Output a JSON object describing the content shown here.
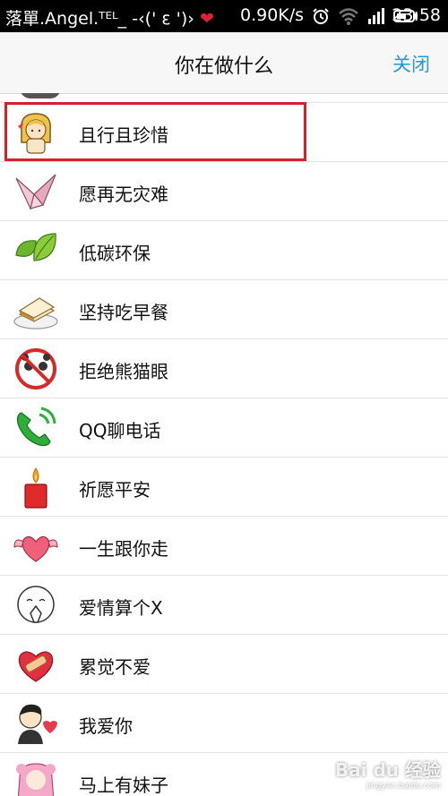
{
  "status_bar": {
    "carrier": "落單.Angel.ᵀᴱᴸ_ -‹(' ε ')› ",
    "speed": "0.90K/s",
    "time": "23:58",
    "icons": [
      "heart-icon",
      "alarm-icon",
      "wifi-icon",
      "signal-icon",
      "battery-icon"
    ]
  },
  "header": {
    "title": "你在做什么",
    "close_label": "关闭",
    "accent_color": "#2a95d8"
  },
  "items": [
    {
      "label": "且行且珍惜",
      "icon": "girl-icon",
      "selected": true
    },
    {
      "label": "愿再无灾难",
      "icon": "paper-crane-icon"
    },
    {
      "label": "低碳环保",
      "icon": "green-leaf-icon"
    },
    {
      "label": "坚持吃早餐",
      "icon": "sandwich-icon"
    },
    {
      "label": "拒绝熊猫眼",
      "icon": "no-panda-icon"
    },
    {
      "label": "QQ聊电话",
      "icon": "phone-icon"
    },
    {
      "label": "祈愿平安",
      "icon": "candle-icon"
    },
    {
      "label": "一生跟你走",
      "icon": "winged-heart-icon"
    },
    {
      "label": "爱情算个X",
      "icon": "shy-face-icon"
    },
    {
      "label": "累觉不爱",
      "icon": "bandaged-heart-icon"
    },
    {
      "label": "我爱你",
      "icon": "couple-icon"
    },
    {
      "label": "马上有妹子",
      "icon": "pink-girl-icon"
    }
  ],
  "highlight_color": "#d6202a",
  "watermark": {
    "text": "Bai du 经验",
    "url": "jingyan.baidu.com"
  }
}
